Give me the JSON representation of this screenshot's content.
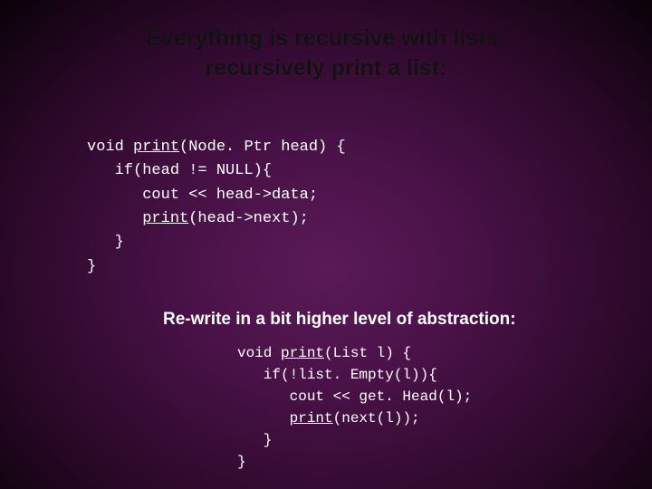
{
  "title_line1": "Everything is recursive with lists:",
  "title_line2": "recursively print a list:",
  "code1": {
    "l1a": "void ",
    "l1b": "print",
    "l1c": "(Node. Ptr head) {",
    "l2": "   if(head != NULL){",
    "l3": "      cout << head->data;",
    "l4a": "      ",
    "l4b": "print",
    "l4c": "(head->next);",
    "l5": "   }",
    "l6": "}"
  },
  "subheading": "Re-write in a bit higher level of abstraction:",
  "code2": {
    "l1a": "void ",
    "l1b": "print",
    "l1c": "(List l) {",
    "l2": "   if(!list. Empty(l)){",
    "l3": "      cout << get. Head(l);",
    "l4a": "      ",
    "l4b": "print",
    "l4c": "(next(l));",
    "l5": "   }",
    "l6": "}"
  }
}
